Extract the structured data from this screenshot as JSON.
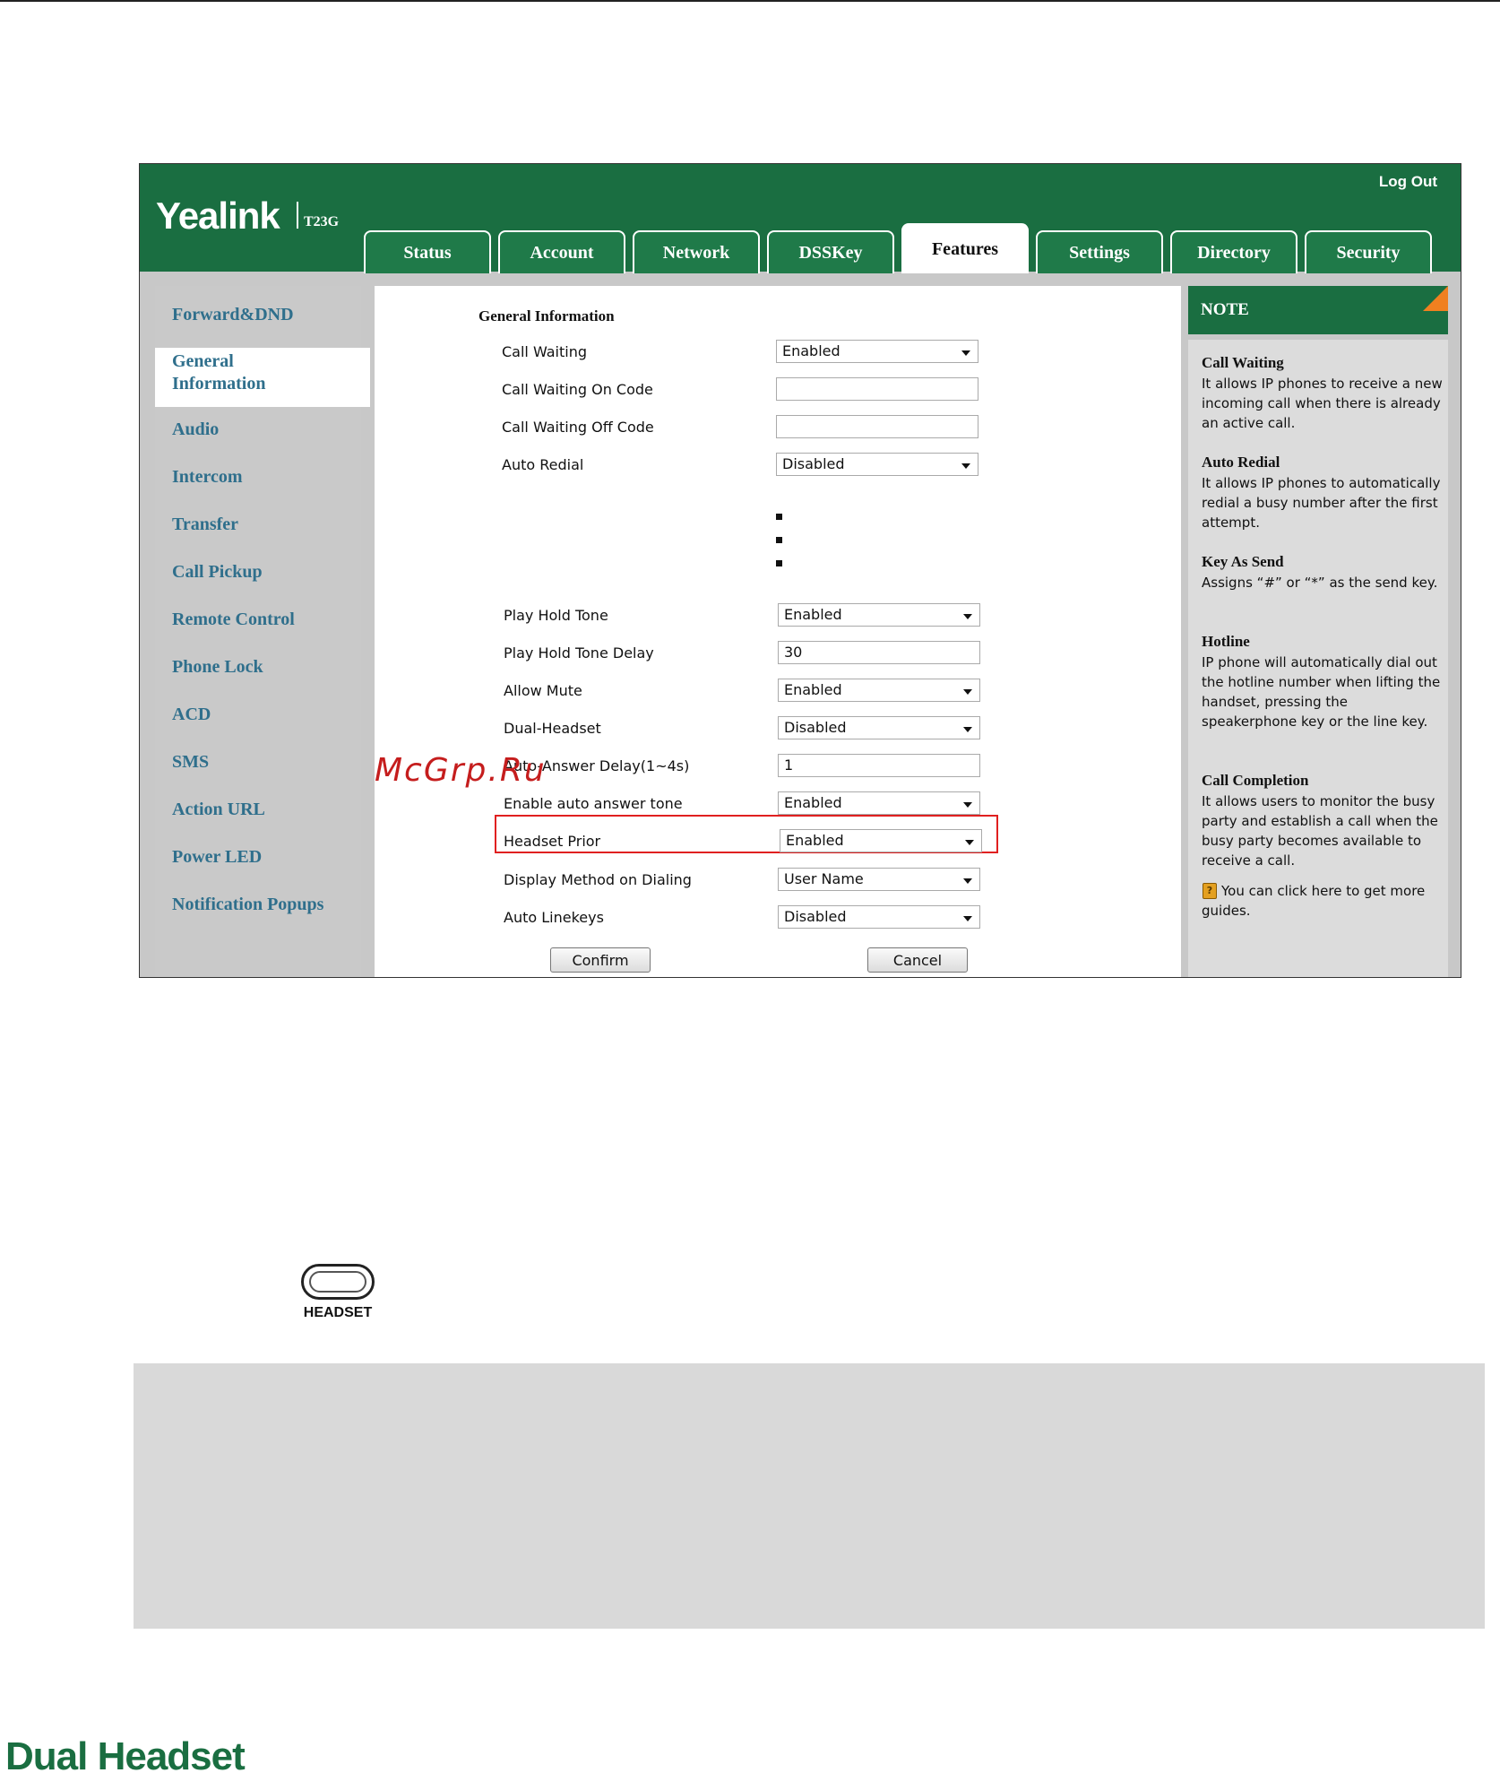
{
  "header": {
    "brand": "Yealink",
    "model": "T23G",
    "logout": "Log Out"
  },
  "tabs": [
    {
      "label": "Status",
      "active": false
    },
    {
      "label": "Account",
      "active": false
    },
    {
      "label": "Network",
      "active": false
    },
    {
      "label": "DSSKey",
      "active": false
    },
    {
      "label": "Features",
      "active": true
    },
    {
      "label": "Settings",
      "active": false
    },
    {
      "label": "Directory",
      "active": false
    },
    {
      "label": "Security",
      "active": false
    }
  ],
  "sidebar": {
    "items": [
      "Forward&DND",
      "General Information",
      "Audio",
      "Intercom",
      "Transfer",
      "Call Pickup",
      "Remote Control",
      "Phone Lock",
      "ACD",
      "SMS",
      "Action URL",
      "Power LED",
      "Notification Popups"
    ],
    "active": "General Information"
  },
  "form": {
    "title": "General Information",
    "fields": {
      "call_waiting": {
        "label": "Call Waiting",
        "value": "Enabled"
      },
      "call_waiting_on": {
        "label": "Call Waiting On Code",
        "value": ""
      },
      "call_waiting_off": {
        "label": "Call Waiting Off Code",
        "value": ""
      },
      "auto_redial": {
        "label": "Auto Redial",
        "value": "Disabled"
      },
      "play_hold_tone": {
        "label": "Play Hold Tone",
        "value": "Enabled"
      },
      "play_hold_tone_delay": {
        "label": "Play Hold Tone Delay",
        "value": "30"
      },
      "allow_mute": {
        "label": "Allow Mute",
        "value": "Enabled"
      },
      "dual_headset": {
        "label": "Dual-Headset",
        "value": "Disabled"
      },
      "auto_answer_delay": {
        "label": "Auto-Answer Delay(1~4s)",
        "value": "1"
      },
      "auto_answer_tone": {
        "label": "Enable auto answer tone",
        "value": "Enabled"
      },
      "headset_prior": {
        "label": "Headset Prior",
        "value": "Enabled"
      },
      "display_method": {
        "label": "Display Method on Dialing",
        "value": "User Name"
      },
      "auto_linekeys": {
        "label": "Auto Linekeys",
        "value": "Disabled"
      }
    },
    "confirm": "Confirm",
    "cancel": "Cancel"
  },
  "watermark": "McGrp.Ru",
  "note": {
    "title": "NOTE",
    "sections": [
      {
        "title": "Call Waiting",
        "text": "It allows IP phones to receive a new incoming call when there is already an active call."
      },
      {
        "title": "Auto Redial",
        "text": "It allows IP phones to automatically redial a busy number after the first attempt."
      },
      {
        "title": "Key As Send",
        "text": "Assigns “#” or “*” as the send key."
      },
      {
        "title": "Hotline",
        "text": "IP phone will automatically dial out the hotline number when lifting the handset, pressing the speakerphone key or the line key."
      },
      {
        "title": "Call Completion",
        "text": "It allows users to monitor the busy party and establish a call when the busy party becomes available to receive a call."
      }
    ],
    "guide": "You can click here to get more guides."
  },
  "headset_key": {
    "label": "HEADSET"
  },
  "section_title": "Dual Headset",
  "colors": {
    "brand_green": "#1a6e41",
    "highlight_red": "#e02020",
    "link_blue": "#2f6f8c",
    "note_corner": "#f08020"
  }
}
